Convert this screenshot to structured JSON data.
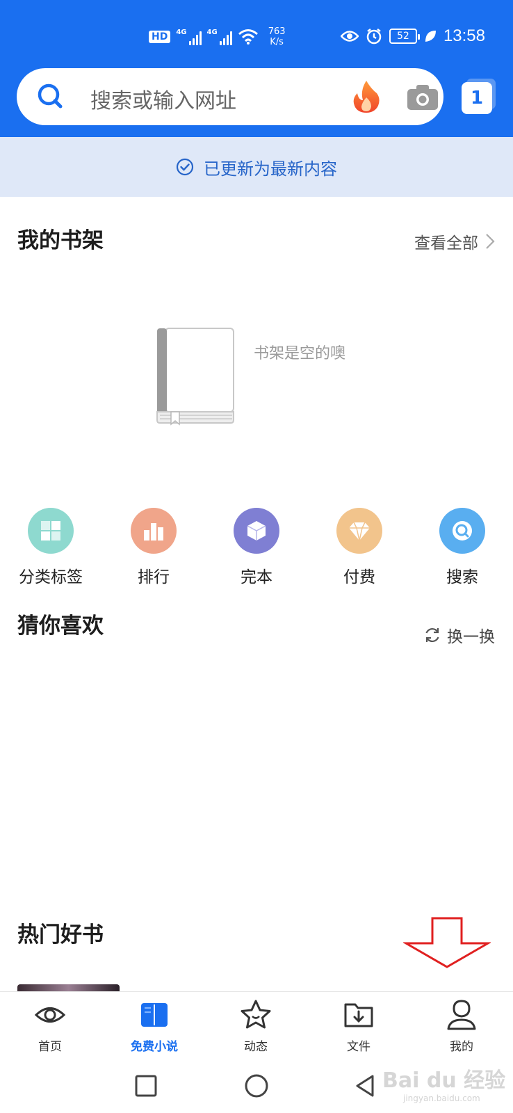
{
  "status_bar": {
    "hd": "HD",
    "net1": "4G",
    "net2": "4G",
    "speed_value": "763",
    "speed_unit": "K/s",
    "battery": "52",
    "time": "13:58"
  },
  "search": {
    "placeholder": "搜索或输入网址",
    "tab_count": "1"
  },
  "update_banner": {
    "text": "已更新为最新内容"
  },
  "bookshelf": {
    "title": "我的书架",
    "see_all": "查看全部",
    "empty_text": "书架是空的噢"
  },
  "categories": [
    {
      "label": "分类标签",
      "icon": "category-tag-icon",
      "color": "#8ed9cf"
    },
    {
      "label": "排行",
      "icon": "ranking-icon",
      "color": "#f0a58a"
    },
    {
      "label": "完本",
      "icon": "complete-cube-icon",
      "color": "#7f7fd3"
    },
    {
      "label": "付费",
      "icon": "diamond-icon",
      "color": "#f2c48c"
    },
    {
      "label": "搜索",
      "icon": "search-icon",
      "color": "#59aef0"
    }
  ],
  "guess": {
    "title": "猜你喜欢",
    "refresh": "换一换"
  },
  "hot_books": {
    "title": "热门好书"
  },
  "bottom_nav": [
    {
      "label": "首页",
      "icon": "eye-icon",
      "active": false
    },
    {
      "label": "免费小说",
      "icon": "book-icon",
      "active": true
    },
    {
      "label": "动态",
      "icon": "star-icon",
      "active": false
    },
    {
      "label": "文件",
      "icon": "download-folder-icon",
      "active": false
    },
    {
      "label": "我的",
      "icon": "profile-icon",
      "active": false
    }
  ],
  "colors": {
    "brand_blue": "#1a6ff0",
    "banner_bg": "#dfe8f8",
    "annotation_red": "#e02020"
  },
  "watermark": {
    "brand": "Bai du 经验",
    "url": "jingyan.baidu.com"
  }
}
